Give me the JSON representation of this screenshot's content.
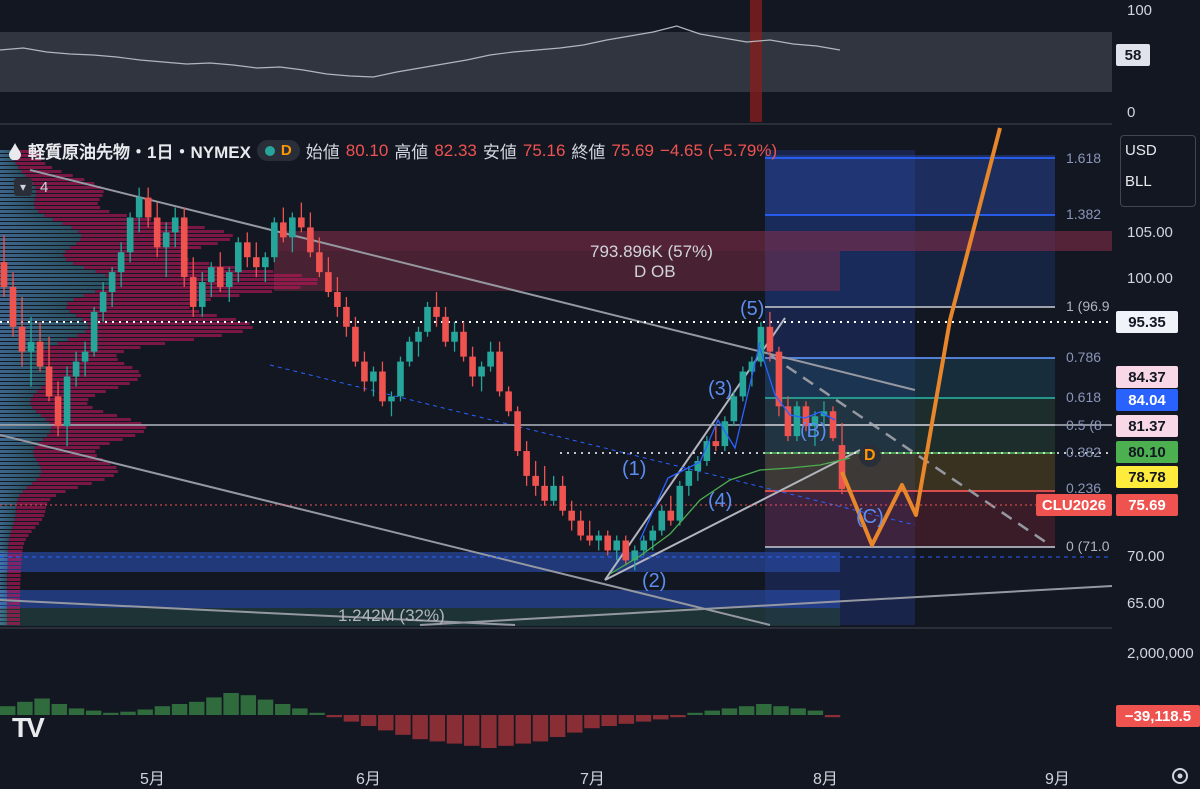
{
  "symbol": {
    "name": "軽質原油先物・1日・NYMEX",
    "badge": "D",
    "open_label": "始値",
    "open": "80.10",
    "high_label": "高値",
    "high": "82.33",
    "low_label": "安値",
    "low": "75.16",
    "close_label": "終値",
    "close": "75.69",
    "change": "−4.65 (−5.79%)"
  },
  "indicator_count": "4",
  "currency": {
    "line1": "USD",
    "line2": "BLL"
  },
  "rsi_pane": {
    "ticks": [
      "100",
      "0"
    ],
    "value_tag": "58",
    "value": 58
  },
  "price_scale": {
    "ticks": [
      "105.00",
      "100.00",
      "70.00",
      "65.00"
    ],
    "volume_tick": "2,000,000",
    "macd_tag": "−39,118.5",
    "tags": [
      {
        "label": "95.35",
        "price": 95.35,
        "bg": "#f0f3fa",
        "fg": "#131722"
      },
      {
        "label": "84.37",
        "price": 84.37,
        "bg": "#f8d7e6",
        "fg": "#131722"
      },
      {
        "label": "84.04",
        "price": 84.04,
        "bg": "#2962ff",
        "fg": "#ffffff"
      },
      {
        "label": "81.37",
        "price": 81.37,
        "bg": "#f8d7e6",
        "fg": "#131722"
      },
      {
        "label": "80.10",
        "price": 80.1,
        "bg": "#4caf50",
        "fg": "#131722"
      },
      {
        "label": "78.78",
        "price": 78.78,
        "bg": "#ffeb3b",
        "fg": "#131722"
      },
      {
        "label": "75.69",
        "price": 75.69,
        "bg": "#ef5350",
        "fg": "#ffffff"
      }
    ],
    "contract_tag": "CLU2026"
  },
  "x_axis": {
    "labels": [
      "5月",
      "6月",
      "7月",
      "8月",
      "9月"
    ]
  },
  "annotations": {
    "ob_volume": "793.896K (57%)",
    "ob_name": "D OB",
    "bottom_volume": "1.242M (32%)",
    "waves": [
      "(1)",
      "(2)",
      "(3)",
      "(4)",
      "(5)",
      "(B)",
      "(C)"
    ],
    "d_marker": "D"
  },
  "fib_levels": [
    {
      "label": "1.618"
    },
    {
      "label": "1.382"
    },
    {
      "label": "1 (96.9"
    },
    {
      "label": "0.786"
    },
    {
      "label": "0.618"
    },
    {
      "label": "0.5 (8"
    },
    {
      "label": "0.382"
    },
    {
      "label": "0.236"
    },
    {
      "label": "0 (71.0"
    }
  ],
  "colors": {
    "up": "#26a69a",
    "down": "#ef5350",
    "bg": "#131722",
    "fib": "#2962ff",
    "projection": "#e8862b"
  },
  "chart_data": {
    "type": "candlestick",
    "x_labels": [
      "5月",
      "6月",
      "7月",
      "8月",
      "9月"
    ],
    "ylim": [
      62,
      112
    ],
    "candles": [
      [
        98.5,
        101.2,
        95.0,
        96.0
      ],
      [
        96.0,
        97.5,
        91.0,
        92.0
      ],
      [
        92.0,
        95.0,
        88.0,
        89.5
      ],
      [
        89.5,
        93.0,
        86.0,
        90.5
      ],
      [
        90.5,
        92.5,
        87.5,
        88.0
      ],
      [
        88.0,
        91.0,
        84.5,
        85.0
      ],
      [
        85.0,
        86.5,
        81.0,
        82.0
      ],
      [
        82.0,
        88.0,
        80.0,
        87.0
      ],
      [
        87.0,
        89.5,
        86.0,
        88.5
      ],
      [
        88.5,
        90.5,
        87.0,
        89.5
      ],
      [
        89.5,
        94.0,
        89.0,
        93.5
      ],
      [
        93.5,
        96.5,
        92.5,
        95.5
      ],
      [
        95.5,
        98.0,
        94.0,
        97.5
      ],
      [
        97.5,
        100.5,
        96.0,
        99.5
      ],
      [
        99.5,
        103.5,
        98.5,
        103.0
      ],
      [
        103.0,
        106.0,
        101.5,
        105.0
      ],
      [
        105.0,
        106.0,
        102.0,
        103.0
      ],
      [
        103.0,
        104.5,
        99.0,
        100.0
      ],
      [
        100.0,
        102.5,
        97.0,
        101.5
      ],
      [
        101.5,
        104.0,
        100.0,
        103.0
      ],
      [
        103.0,
        104.0,
        96.0,
        97.0
      ],
      [
        97.0,
        99.0,
        93.0,
        94.0
      ],
      [
        94.0,
        97.5,
        93.0,
        96.5
      ],
      [
        96.5,
        98.5,
        95.0,
        98.0
      ],
      [
        98.0,
        99.5,
        95.5,
        96.0
      ],
      [
        96.0,
        98.0,
        94.5,
        97.5
      ],
      [
        97.5,
        101.0,
        96.5,
        100.5
      ],
      [
        100.5,
        101.5,
        98.0,
        99.0
      ],
      [
        99.0,
        100.5,
        97.0,
        98.0
      ],
      [
        98.0,
        99.5,
        96.5,
        99.0
      ],
      [
        99.0,
        103.0,
        98.5,
        102.5
      ],
      [
        102.5,
        104.0,
        100.5,
        101.0
      ],
      [
        101.0,
        103.5,
        99.5,
        103.0
      ],
      [
        103.0,
        104.5,
        101.5,
        102.0
      ],
      [
        102.0,
        103.5,
        99.0,
        99.5
      ],
      [
        99.5,
        101.0,
        97.0,
        97.5
      ],
      [
        97.5,
        99.0,
        95.0,
        95.5
      ],
      [
        95.5,
        97.0,
        93.0,
        94.0
      ],
      [
        94.0,
        95.0,
        91.0,
        92.0
      ],
      [
        92.0,
        93.0,
        88.0,
        88.5
      ],
      [
        88.5,
        89.5,
        85.5,
        86.5
      ],
      [
        86.5,
        88.0,
        85.0,
        87.5
      ],
      [
        87.5,
        88.5,
        84.0,
        84.5
      ],
      [
        84.5,
        85.5,
        83.0,
        85.0
      ],
      [
        85.0,
        89.0,
        84.5,
        88.5
      ],
      [
        88.5,
        91.0,
        88.0,
        90.5
      ],
      [
        90.5,
        92.0,
        89.0,
        91.5
      ],
      [
        91.5,
        94.5,
        91.0,
        94.0
      ],
      [
        94.0,
        95.5,
        92.0,
        93.0
      ],
      [
        93.0,
        94.0,
        90.0,
        90.5
      ],
      [
        90.5,
        92.5,
        89.5,
        91.5
      ],
      [
        91.5,
        92.5,
        88.5,
        89.0
      ],
      [
        89.0,
        90.0,
        86.0,
        87.0
      ],
      [
        87.0,
        88.5,
        85.5,
        88.0
      ],
      [
        88.0,
        90.5,
        87.5,
        89.5
      ],
      [
        89.5,
        90.5,
        85.0,
        85.5
      ],
      [
        85.5,
        86.0,
        83.0,
        83.5
      ],
      [
        83.5,
        84.0,
        79.0,
        79.5
      ],
      [
        79.5,
        80.5,
        76.0,
        77.0
      ],
      [
        77.0,
        78.5,
        75.0,
        76.0
      ],
      [
        76.0,
        78.0,
        74.0,
        74.5
      ],
      [
        74.5,
        77.0,
        74.0,
        76.0
      ],
      [
        76.0,
        77.0,
        73.0,
        73.5
      ],
      [
        73.5,
        74.5,
        71.5,
        72.5
      ],
      [
        72.5,
        73.5,
        70.5,
        71.0
      ],
      [
        71.0,
        72.5,
        70.0,
        70.5
      ],
      [
        70.5,
        71.5,
        69.5,
        71.0
      ],
      [
        71.0,
        71.5,
        69.0,
        69.5
      ],
      [
        69.5,
        71.0,
        68.5,
        70.5
      ],
      [
        70.5,
        71.0,
        68.0,
        68.5
      ],
      [
        68.5,
        70.0,
        67.5,
        69.5
      ],
      [
        69.5,
        71.0,
        69.0,
        70.5
      ],
      [
        70.5,
        72.0,
        69.5,
        71.5
      ],
      [
        71.5,
        74.0,
        71.0,
        73.5
      ],
      [
        73.5,
        75.0,
        72.0,
        72.5
      ],
      [
        72.5,
        76.5,
        72.0,
        76.0
      ],
      [
        76.0,
        78.0,
        75.0,
        77.5
      ],
      [
        77.5,
        79.0,
        76.5,
        78.5
      ],
      [
        78.5,
        81.0,
        78.0,
        80.5
      ],
      [
        80.5,
        82.0,
        79.5,
        80.0
      ],
      [
        80.0,
        83.0,
        79.5,
        82.5
      ],
      [
        82.5,
        85.5,
        82.0,
        85.0
      ],
      [
        85.0,
        88.0,
        84.5,
        87.5
      ],
      [
        87.5,
        89.0,
        86.0,
        88.5
      ],
      [
        88.5,
        92.5,
        88.0,
        92.0
      ],
      [
        92.0,
        93.5,
        88.5,
        89.5
      ],
      [
        89.5,
        90.0,
        83.0,
        84.0
      ],
      [
        84.0,
        85.0,
        80.5,
        81.0
      ],
      [
        81.0,
        84.5,
        80.5,
        84.0
      ],
      [
        84.0,
        84.5,
        81.5,
        82.0
      ],
      [
        82.0,
        83.5,
        80.0,
        83.0
      ],
      [
        83.0,
        84.5,
        82.0,
        83.5
      ],
      [
        83.5,
        84.0,
        80.5,
        80.8
      ],
      [
        80.1,
        82.33,
        75.16,
        75.69
      ]
    ],
    "rsi": [
      62,
      64,
      60,
      58,
      57,
      55,
      52,
      50,
      48,
      49,
      47,
      44,
      45,
      42,
      38,
      36,
      35,
      40,
      44,
      48,
      52,
      57,
      60,
      62,
      64,
      67,
      72,
      76,
      80,
      86,
      78,
      74,
      70,
      72,
      68,
      66,
      62
    ],
    "macd_histogram": [
      8,
      12,
      15,
      10,
      6,
      4,
      2,
      3,
      5,
      8,
      10,
      12,
      16,
      20,
      18,
      14,
      10,
      6,
      2,
      -2,
      -6,
      -10,
      -14,
      -18,
      -22,
      -24,
      -26,
      -28,
      -30,
      -28,
      -26,
      -24,
      -20,
      -16,
      -12,
      -10,
      -8,
      -6,
      -4,
      -2,
      2,
      4,
      6,
      8,
      10,
      8,
      6,
      4,
      -2
    ]
  }
}
